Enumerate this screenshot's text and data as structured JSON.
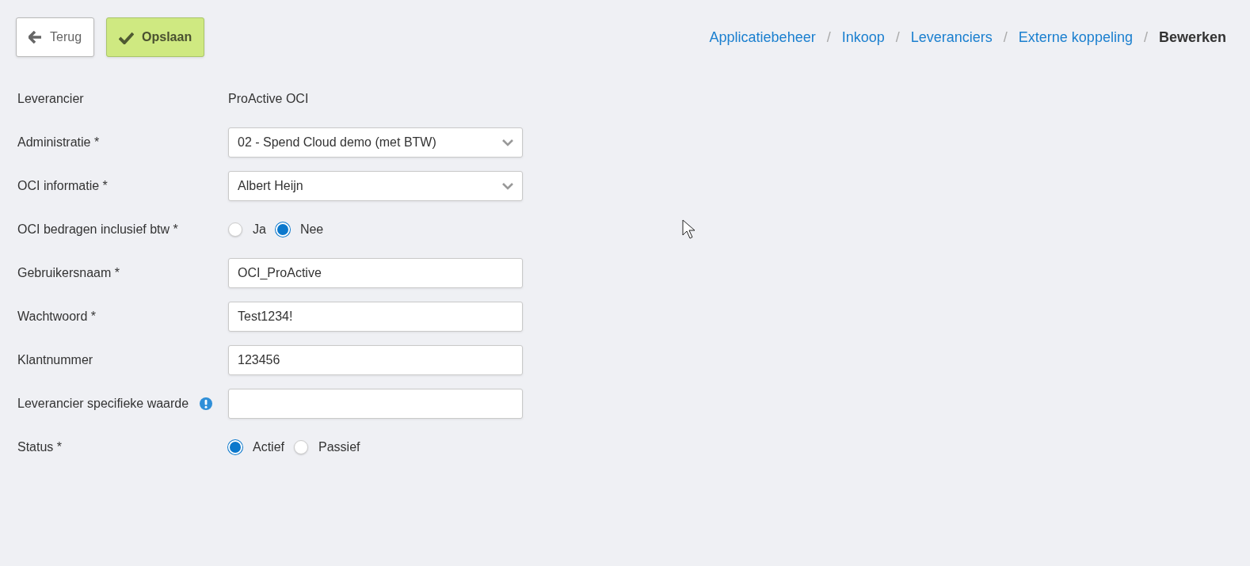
{
  "toolbar": {
    "buttons": [
      {
        "kind": "back",
        "label": "Terug"
      },
      {
        "kind": "save",
        "label": "Opslaan"
      }
    ]
  },
  "breadcrumbs": [
    {
      "label": "Applicatiebeheer",
      "current": false
    },
    {
      "label": "Inkoop",
      "current": false
    },
    {
      "label": "Leveranciers",
      "current": false
    },
    {
      "label": "Externe koppeling",
      "current": false
    },
    {
      "label": "Bewerken",
      "current": true
    }
  ],
  "separator": "/",
  "form": [
    {
      "kind": "text",
      "label": "Leverancier",
      "value": "ProActive OCI"
    },
    {
      "kind": "select",
      "label": "Administratie *",
      "value": "02 - Spend Cloud demo (met BTW)"
    },
    {
      "kind": "select",
      "label": "OCI informatie *",
      "value": "Albert Heijn"
    },
    {
      "kind": "radio",
      "label": "OCI bedragen inclusief btw *",
      "options": [
        {
          "label": "Ja",
          "selected": false
        },
        {
          "label": "Nee",
          "selected": true
        }
      ]
    },
    {
      "kind": "input",
      "label": "Gebruikersnaam *",
      "value": "OCI_ProActive"
    },
    {
      "kind": "input",
      "label": "Wachtwoord *",
      "value": "Test1234!"
    },
    {
      "kind": "input",
      "label": "Klantnummer",
      "value": "123456"
    },
    {
      "kind": "input",
      "label": "Leverancier specifieke waarde",
      "info": true
    },
    {
      "kind": "radio",
      "label": "Status *",
      "options": [
        {
          "label": "Actief",
          "selected": true
        },
        {
          "label": "Passief",
          "selected": false
        }
      ]
    }
  ]
}
